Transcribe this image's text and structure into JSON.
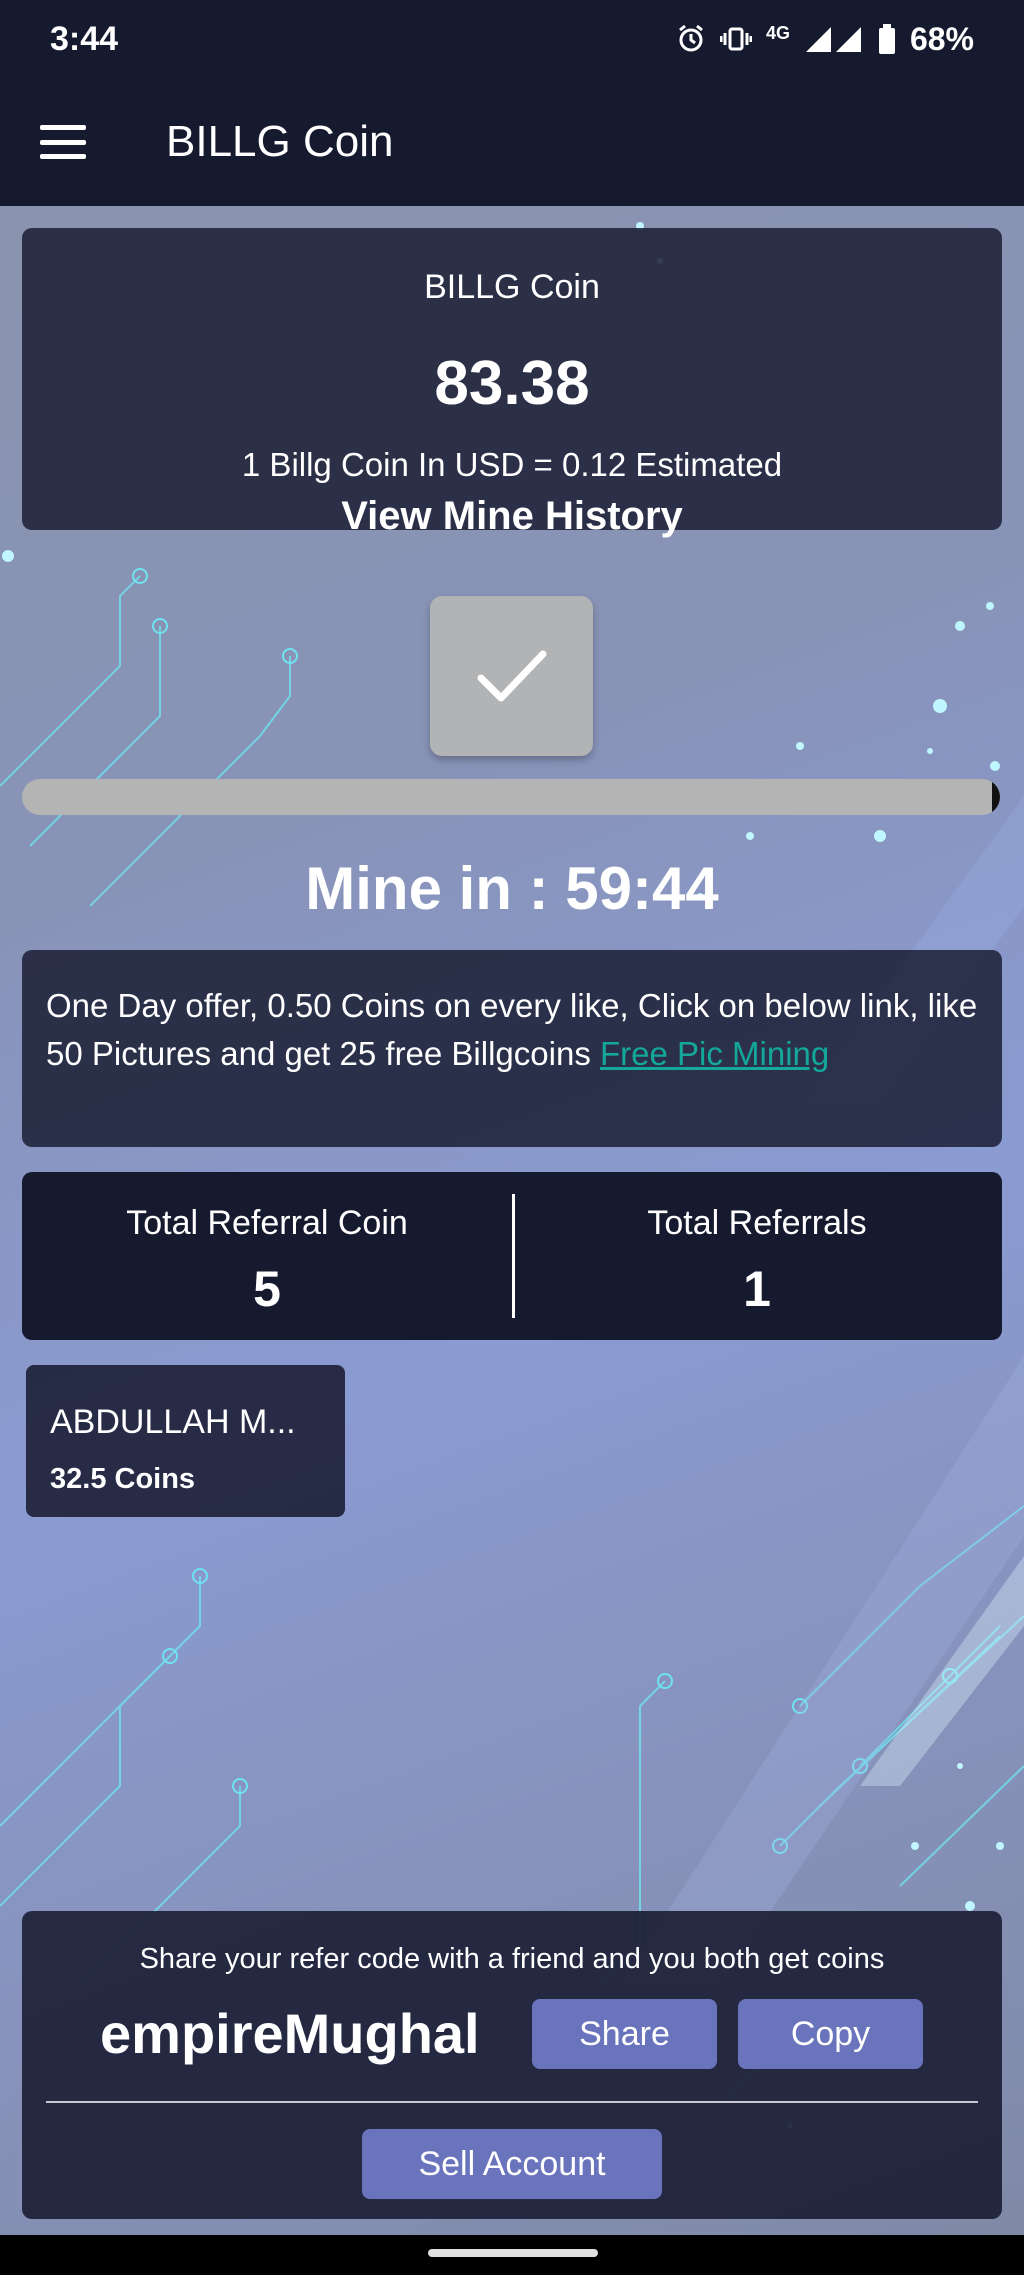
{
  "status_bar": {
    "time": "3:44",
    "network": "4G",
    "battery": "68%"
  },
  "app_bar": {
    "title": "BILLG Coin"
  },
  "coin_card": {
    "label": "BILLG Coin",
    "value": "83.38",
    "rate_text": "1 Billg Coin In USD = 0.12 Estimated",
    "history_link": "View Mine History"
  },
  "mine": {
    "timer_text": "Mine in : 59:44",
    "progress": 0.99
  },
  "offer": {
    "text": "One Day offer, 0.50 Coins on every like, Click on below link, like 50 Pictures and get 25 free Billgcoins ",
    "link_text": "Free Pic Mining "
  },
  "referrals": {
    "coin_label": "Total Referral Coin",
    "coin_value": "5",
    "count_label": "Total Referrals",
    "count_value": "1"
  },
  "referral_users": [
    {
      "name": "ABDULLAH M...",
      "coins": "32.5 Coins"
    }
  ],
  "share": {
    "text": "Share your refer code with a friend and you both get coins",
    "code": "empireMughal",
    "share_label": "Share",
    "copy_label": "Copy",
    "sell_label": "Sell Account"
  },
  "colors": {
    "bar": "#161a2e",
    "accent_button": "#6a74bc",
    "link": "#14a89a"
  }
}
